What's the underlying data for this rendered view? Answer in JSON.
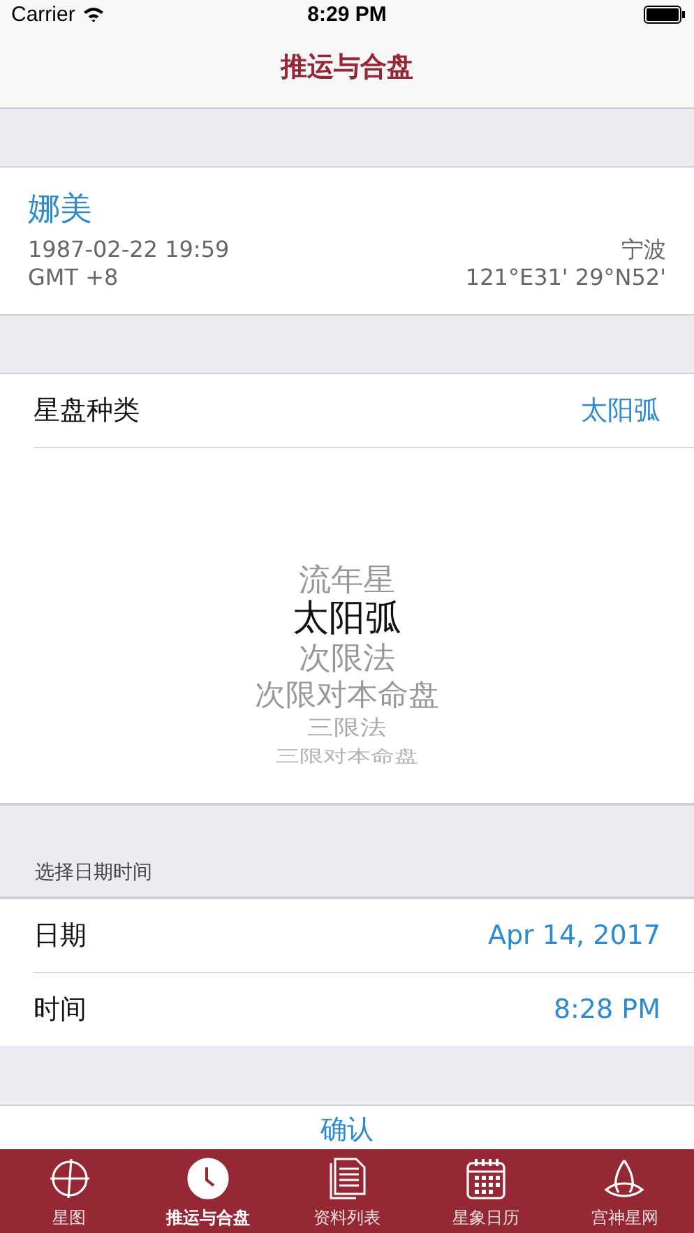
{
  "status_bar": {
    "carrier": "Carrier",
    "time": "8:29 PM"
  },
  "nav": {
    "title": "推运与合盘"
  },
  "profile": {
    "name": "娜美",
    "datetime": "1987-02-22 19:59",
    "timezone": "GMT +8",
    "place": "宁波",
    "coords": "121°E31' 29°N52'"
  },
  "chart_type": {
    "label": "星盘种类",
    "value": "太阳弧"
  },
  "picker": {
    "options": [
      {
        "label": "流年星",
        "selected": false
      },
      {
        "label": "太阳弧",
        "selected": true
      },
      {
        "label": "次限法",
        "selected": false
      },
      {
        "label": "次限对本命盘",
        "selected": false
      },
      {
        "label": "三限法",
        "selected": false
      },
      {
        "label": "三限对本命盘",
        "selected": false
      }
    ]
  },
  "datetime_section": {
    "header": "选择日期时间",
    "rows": [
      {
        "label": "日期",
        "value": "Apr 14, 2017"
      },
      {
        "label": "时间",
        "value": "8:28 PM"
      }
    ]
  },
  "confirm": "确认",
  "tab_bar": [
    {
      "label": "星图",
      "selected": false
    },
    {
      "label": "推运与合盘",
      "selected": true
    },
    {
      "label": "资料列表",
      "selected": false
    },
    {
      "label": "星象日历",
      "selected": false
    },
    {
      "label": "宫神星网",
      "selected": false
    }
  ]
}
